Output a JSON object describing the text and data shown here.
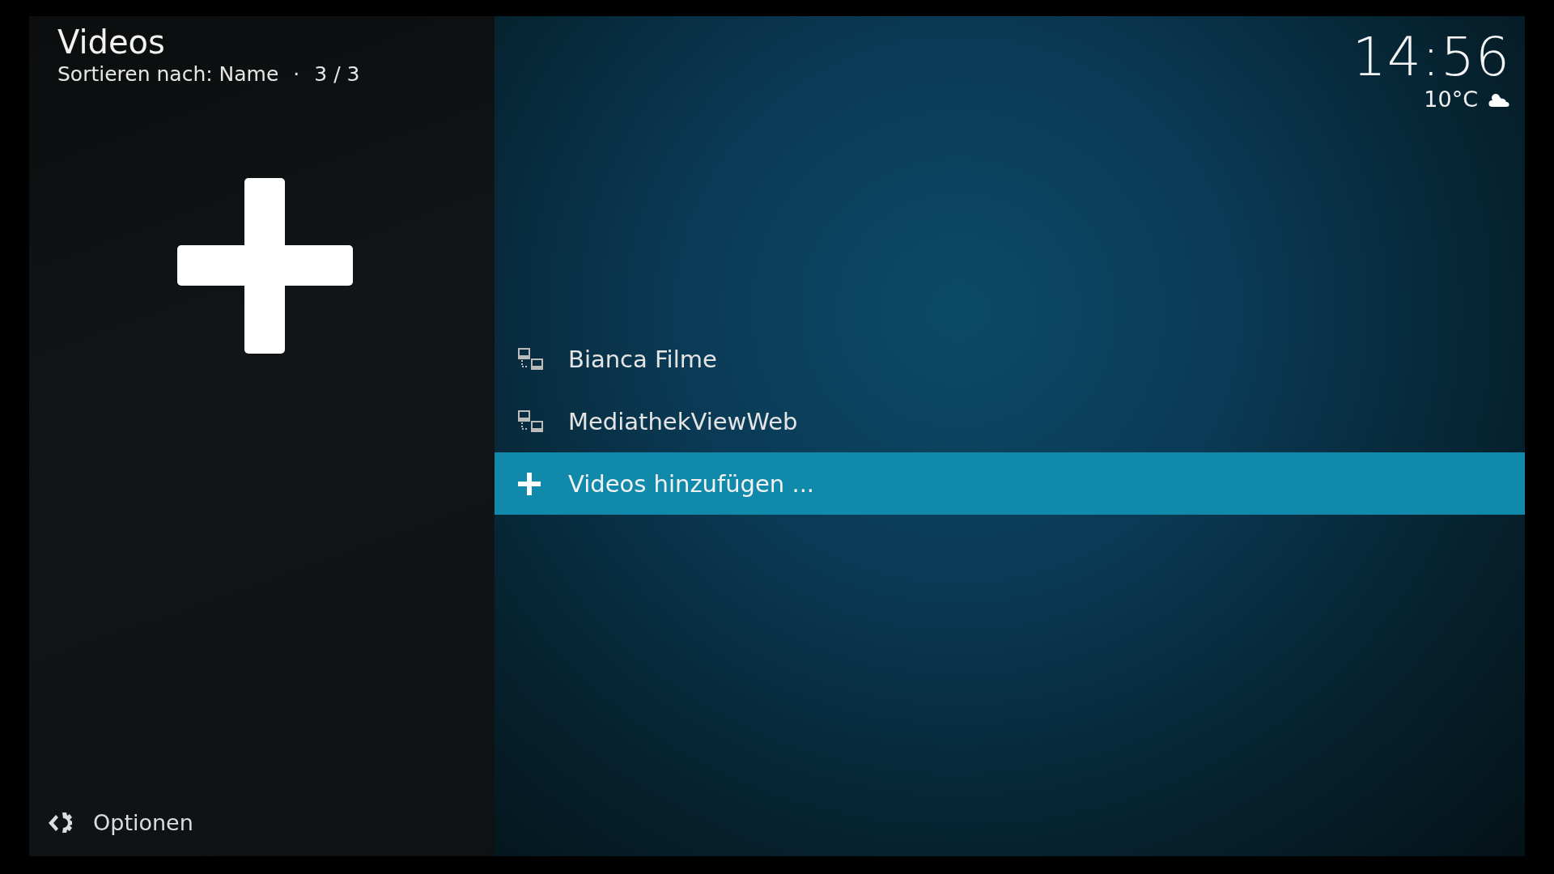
{
  "header": {
    "title": "Videos",
    "subtitle": "Sortieren nach: Name",
    "separator": "·",
    "count": "3 / 3"
  },
  "clock": {
    "time": "14:56",
    "temperature": "10°C"
  },
  "items": [
    {
      "kind": "source",
      "label": "Bianca Filme",
      "selected": false
    },
    {
      "kind": "source",
      "label": "MediathekViewWeb",
      "selected": false
    },
    {
      "kind": "add",
      "label": "Videos hinzufügen ...",
      "selected": true
    }
  ],
  "options": {
    "label": "Optionen"
  }
}
